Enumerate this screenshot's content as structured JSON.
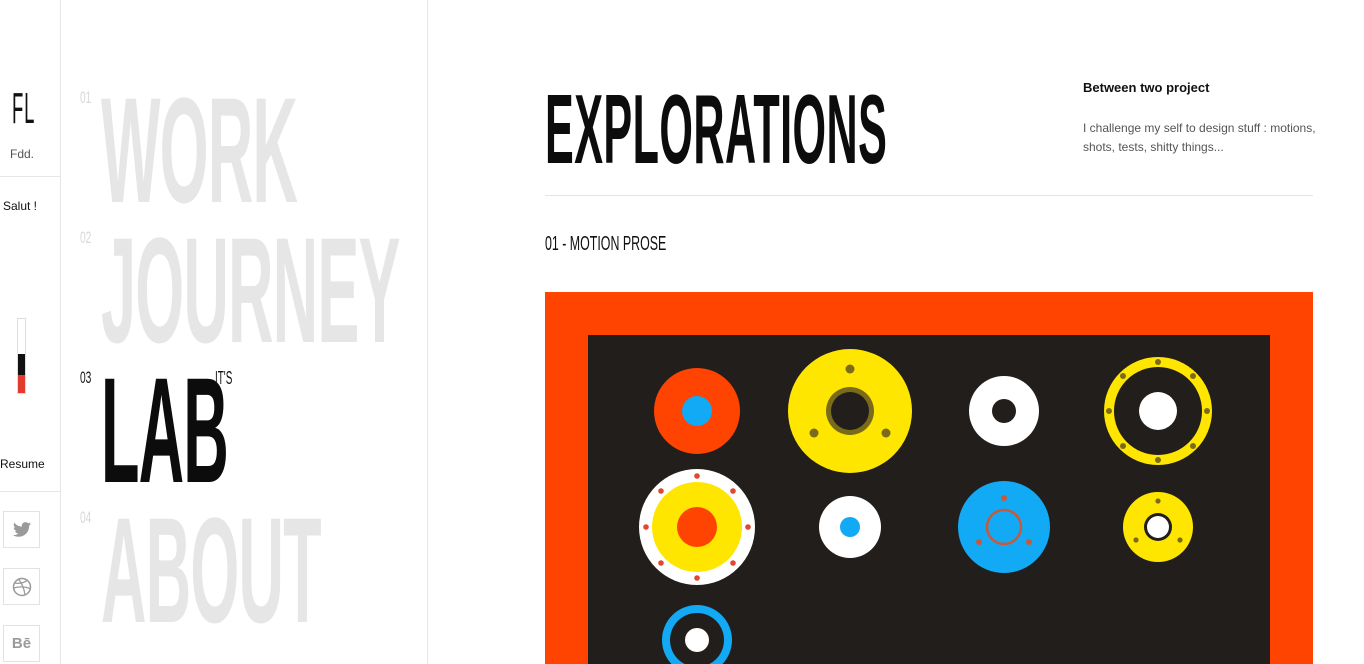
{
  "sidebar": {
    "logo": "FL",
    "sublogo": "Fdd.",
    "greeting": "Salut !",
    "progress": {
      "black_fraction": 0.28,
      "red_fraction": 0.24
    },
    "resume_label": "Resume",
    "social": [
      {
        "icon": "twitter-icon"
      },
      {
        "icon": "dribbble-icon"
      },
      {
        "icon": "behance-icon",
        "label": "Bē"
      }
    ]
  },
  "menu": {
    "items": [
      {
        "num": "01",
        "label": "WORK"
      },
      {
        "num": "02",
        "label": "JOURNEY"
      },
      {
        "num": "03",
        "label": "LAB",
        "tag": "IT'S",
        "active": true
      },
      {
        "num": "04",
        "label": "ABOUT"
      }
    ]
  },
  "main": {
    "title": "EXPLORATIONS",
    "intro": {
      "heading": "Between two project",
      "body": "I challenge my self to design stuff : motions, shots, tests, shitty things..."
    },
    "section_title": "01 - MOTION PROSE"
  },
  "colors": {
    "frame": "#ff4300",
    "canvas": "#221e1c",
    "yellow": "#ffe600",
    "blue": "#12a9f5",
    "white": "#ffffff",
    "muted_text": "#e6e6e6"
  }
}
